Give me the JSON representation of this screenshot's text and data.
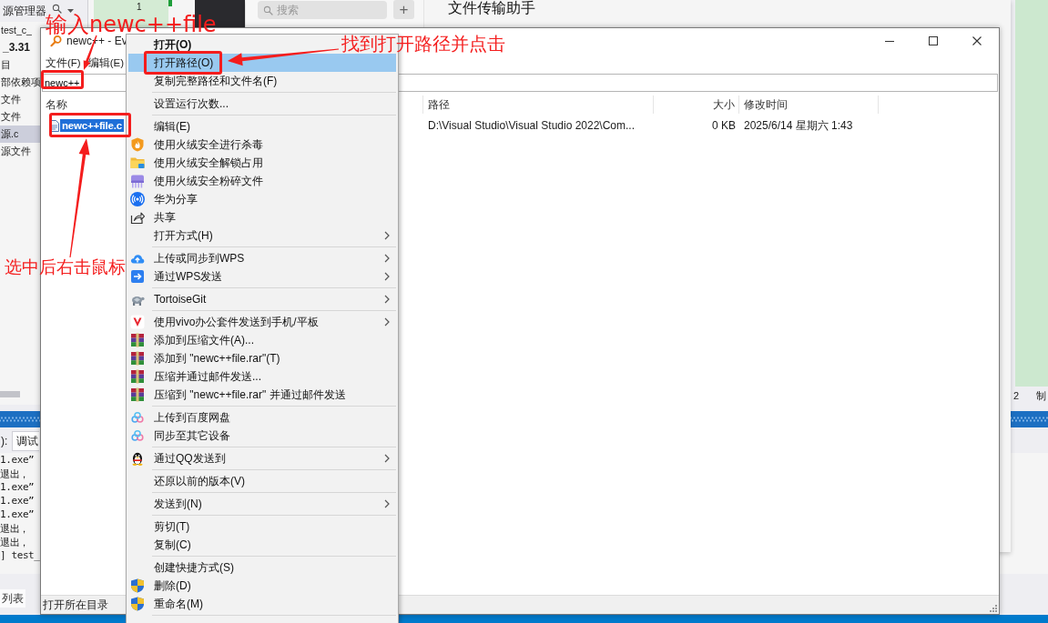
{
  "vs_window": {
    "explorer": {
      "title": "源管理器",
      "items": [
        {
          "label": "test_c_",
          "bold": false,
          "selected": false
        },
        {
          "label": "_3.31",
          "bold": true,
          "selected": false
        },
        {
          "label": "目",
          "bold": false,
          "selected": false
        },
        {
          "label": "部依赖项",
          "bold": false,
          "selected": false
        },
        {
          "label": "文件",
          "bold": false,
          "selected": false
        },
        {
          "label": "文件",
          "bold": false,
          "selected": false
        },
        {
          "label": "源.c",
          "bold": false,
          "selected": true
        },
        {
          "label": "源文件",
          "bold": false,
          "selected": false
        }
      ]
    },
    "preview_text": "1",
    "editor_status": {
      "number": "2",
      "text": "制"
    },
    "output": {
      "source_label": "):",
      "source_value": "调试",
      "lines": [
        "1.exe”",
        "退出，",
        "1.exe”",
        "1.exe”",
        "1.exe”",
        "退出，",
        "退出，",
        "] test_"
      ],
      "tabs": [
        {
          "label": "列表",
          "selected": true
        }
      ]
    }
  },
  "chat_window": {
    "title": "文件传输助手",
    "search": {
      "placeholder": "搜索"
    },
    "add_button": "+"
  },
  "everything_window": {
    "title": "newc++ - Ev",
    "menu": [
      "文件(F)",
      "编辑(E)"
    ],
    "search": {
      "value": "newc++"
    },
    "columns": [
      "名称",
      "路径",
      "大小",
      "修改时间"
    ],
    "rows": [
      {
        "cells": [
          "newc++file.c",
          "D:\\Visual Studio\\Visual Studio 2022\\Com...",
          "0 KB",
          "2025/6/14 星期六 1:43"
        ],
        "selected": true
      }
    ],
    "status_bar": "打开所在目录"
  },
  "context_menu": {
    "groups": [
      [
        {
          "label": "打开(O)",
          "kind": "plain",
          "default": true,
          "selected": false,
          "submenu": false
        },
        {
          "label": "打开路径(O)",
          "kind": "plain",
          "default": false,
          "selected": true,
          "submenu": false
        },
        {
          "label": "复制完整路径和文件名(F)",
          "kind": "plain",
          "default": false,
          "selected": false,
          "submenu": false
        }
      ],
      [
        {
          "label": "设置运行次数...",
          "kind": "plain",
          "default": false,
          "selected": false,
          "submenu": false
        }
      ],
      [
        {
          "label": "编辑(E)",
          "kind": "plain",
          "default": false,
          "selected": false,
          "submenu": false
        },
        {
          "label": "使用火绒安全进行杀毒",
          "kind": "flame-shield",
          "default": false,
          "selected": false,
          "submenu": false
        },
        {
          "label": "使用火绒安全解锁占用",
          "kind": "folder",
          "default": false,
          "selected": false,
          "submenu": false
        },
        {
          "label": "使用火绒安全粉碎文件",
          "kind": "shredder",
          "default": false,
          "selected": false,
          "submenu": false
        },
        {
          "label": "华为分享",
          "kind": "wireless",
          "default": false,
          "selected": false,
          "submenu": false
        },
        {
          "label": "共享",
          "kind": "share",
          "default": false,
          "selected": false,
          "submenu": false
        },
        {
          "label": "打开方式(H)",
          "kind": "plain",
          "default": false,
          "selected": false,
          "submenu": true
        }
      ],
      [
        {
          "label": "上传或同步到WPS",
          "kind": "cloud-upload",
          "default": false,
          "selected": false,
          "submenu": true
        },
        {
          "label": "通过WPS发送",
          "kind": "send",
          "default": false,
          "selected": false,
          "submenu": true
        }
      ],
      [
        {
          "label": "TortoiseGit",
          "kind": "turtle",
          "default": false,
          "selected": false,
          "submenu": true
        }
      ],
      [
        {
          "label": "使用vivo办公套件发送到手机/平板",
          "kind": "vivo",
          "default": false,
          "selected": false,
          "submenu": true
        },
        {
          "label": "添加到压缩文件(A)...",
          "kind": "archive",
          "default": false,
          "selected": false,
          "submenu": false
        },
        {
          "label": "添加到 \"newc++file.rar\"(T)",
          "kind": "archive",
          "default": false,
          "selected": false,
          "submenu": false
        },
        {
          "label": "压缩并通过邮件发送...",
          "kind": "archive",
          "default": false,
          "selected": false,
          "submenu": false
        },
        {
          "label": "压缩到 \"newc++file.rar\" 并通过邮件发送",
          "kind": "archive",
          "default": false,
          "selected": false,
          "submenu": false
        }
      ],
      [
        {
          "label": "上传到百度网盘",
          "kind": "cloud-rings",
          "default": false,
          "selected": false,
          "submenu": false
        },
        {
          "label": "同步至其它设备",
          "kind": "cloud-rings",
          "default": false,
          "selected": false,
          "submenu": false
        }
      ],
      [
        {
          "label": "通过QQ发送到",
          "kind": "penguin",
          "default": false,
          "selected": false,
          "submenu": true
        }
      ],
      [
        {
          "label": "还原以前的版本(V)",
          "kind": "plain",
          "default": false,
          "selected": false,
          "submenu": false
        }
      ],
      [
        {
          "label": "发送到(N)",
          "kind": "plain",
          "default": false,
          "selected": false,
          "submenu": true
        }
      ],
      [
        {
          "label": "剪切(T)",
          "kind": "plain",
          "default": false,
          "selected": false,
          "submenu": false
        },
        {
          "label": "复制(C)",
          "kind": "plain",
          "default": false,
          "selected": false,
          "submenu": false
        }
      ],
      [
        {
          "label": "创建快捷方式(S)",
          "kind": "plain",
          "default": false,
          "selected": false,
          "submenu": false
        },
        {
          "label": "删除(D)",
          "kind": "uac-shield",
          "default": false,
          "selected": false,
          "submenu": false
        },
        {
          "label": "重命名(M)",
          "kind": "uac-shield",
          "default": false,
          "selected": false,
          "submenu": false
        }
      ]
    ]
  },
  "annotations": {
    "search_note": "输入newc++file",
    "menu_note": "找到打开路径并点击",
    "select_note": "选中后右击鼠标"
  }
}
